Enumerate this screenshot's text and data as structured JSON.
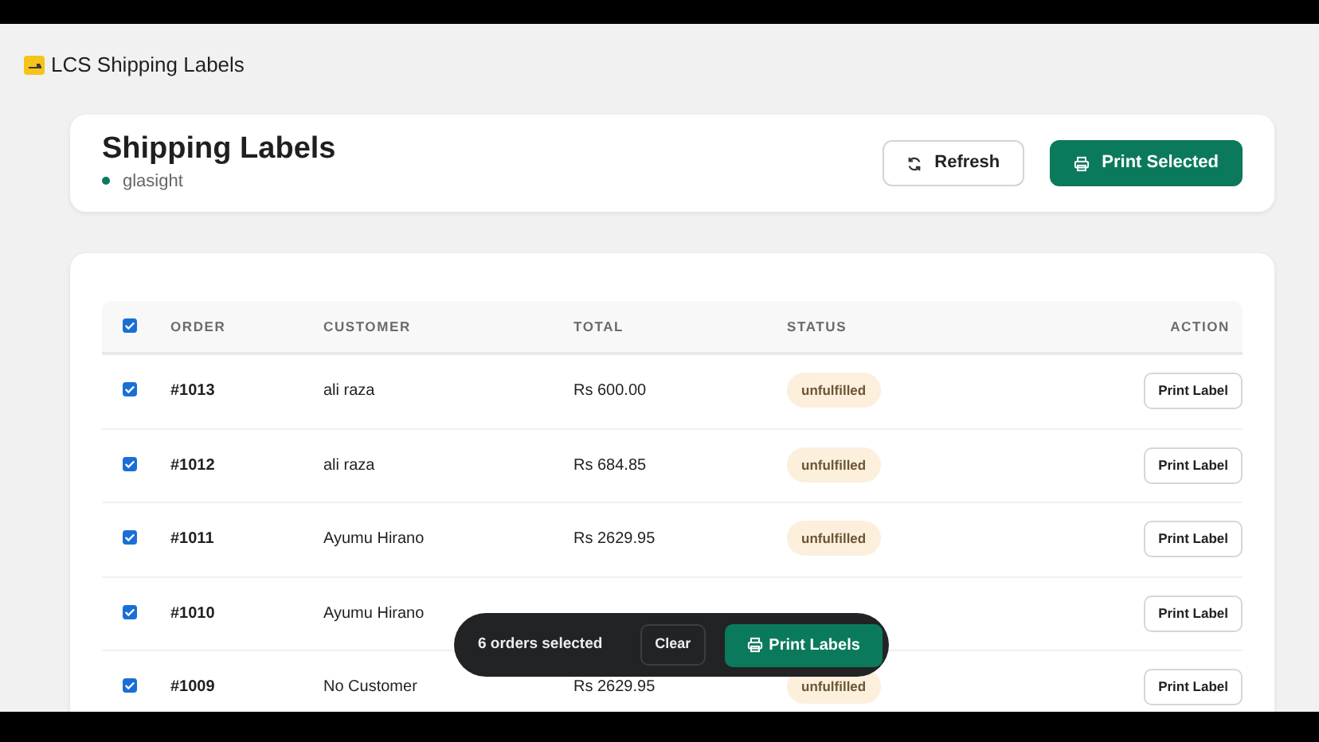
{
  "app": {
    "title": "LCS Shipping Labels"
  },
  "header": {
    "title": "Shipping Labels",
    "store": {
      "name": "glasight",
      "color": "#0d7a5f"
    },
    "buttons": [
      {
        "label": "Refresh",
        "kind": "secondary"
      },
      {
        "label": "Print Selected",
        "kind": "primary"
      }
    ]
  },
  "table": {
    "all_checked": true,
    "columns": [
      "ORDER",
      "CUSTOMER",
      "TOTAL",
      "STATUS",
      "ACTION"
    ],
    "rows": [
      {
        "checked": true,
        "order": "#1013",
        "customer": "ali raza",
        "total": "Rs 600.00",
        "status": "unfulfilled",
        "action": "Print Label"
      },
      {
        "checked": true,
        "order": "#1012",
        "customer": "ali raza",
        "total": "Rs 684.85",
        "status": "unfulfilled",
        "action": "Print Label"
      },
      {
        "checked": true,
        "order": "#1011",
        "customer": "Ayumu Hirano",
        "total": "Rs 2629.95",
        "status": "unfulfilled",
        "action": "Print Label"
      },
      {
        "checked": true,
        "order": "#1010",
        "customer": "Ayumu Hirano",
        "action": "Print Label"
      },
      {
        "checked": true,
        "order": "#1009",
        "customer": "No Customer",
        "total": "Rs 2629.95",
        "status": "unfulfilled",
        "action": "Print Label"
      }
    ]
  },
  "selection_bar": {
    "text": "6 orders selected",
    "clear": "Clear",
    "print": "Print Labels"
  }
}
